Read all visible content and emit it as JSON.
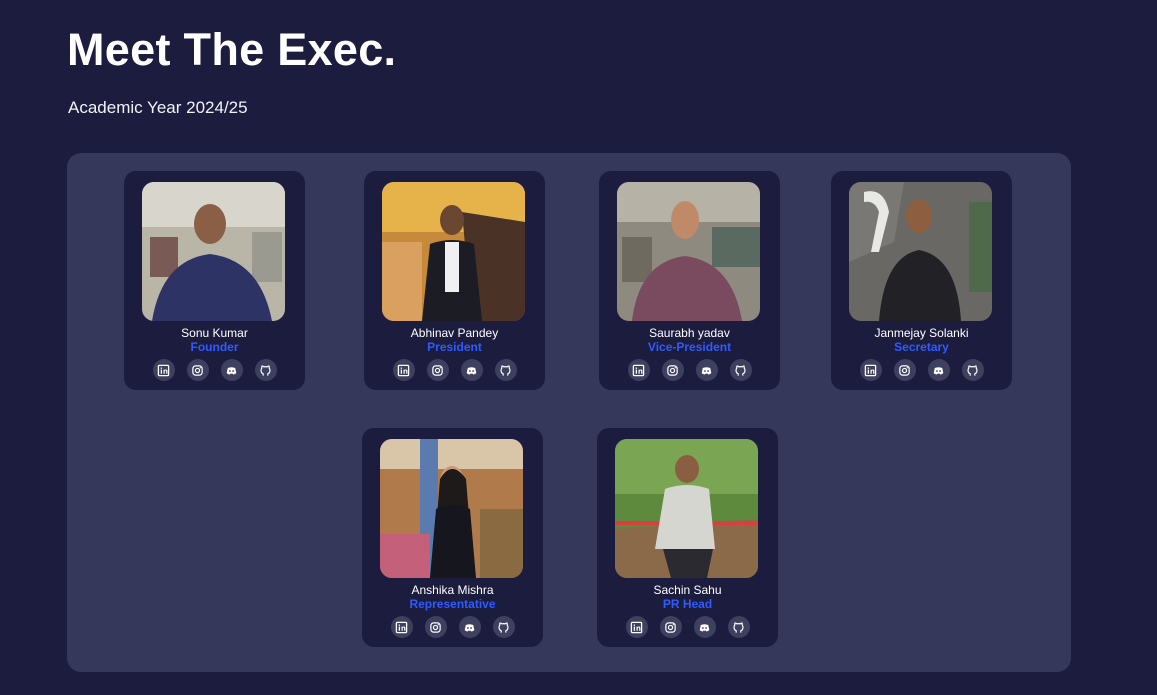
{
  "header": {
    "title": "Meet The Exec.",
    "subtitle": "Academic Year 2024/25"
  },
  "members": [
    {
      "name": "Sonu Kumar",
      "role": "Founder"
    },
    {
      "name": "Abhinav Pandey",
      "role": "President"
    },
    {
      "name": "Saurabh yadav",
      "role": "Vice-President"
    },
    {
      "name": "Janmejay Solanki",
      "role": "Secretary"
    },
    {
      "name": "Anshika Mishra",
      "role": "Representative"
    },
    {
      "name": "Sachin Sahu",
      "role": "PR Head"
    }
  ],
  "social_icons": [
    "linkedin-icon",
    "instagram-icon",
    "discord-icon",
    "github-icon"
  ],
  "colors": {
    "background": "#1c1c3f",
    "panel": "#35385a",
    "card": "#1c1c3f",
    "role_accent": "#2e5bff",
    "icon_circle": "#3e4060"
  }
}
